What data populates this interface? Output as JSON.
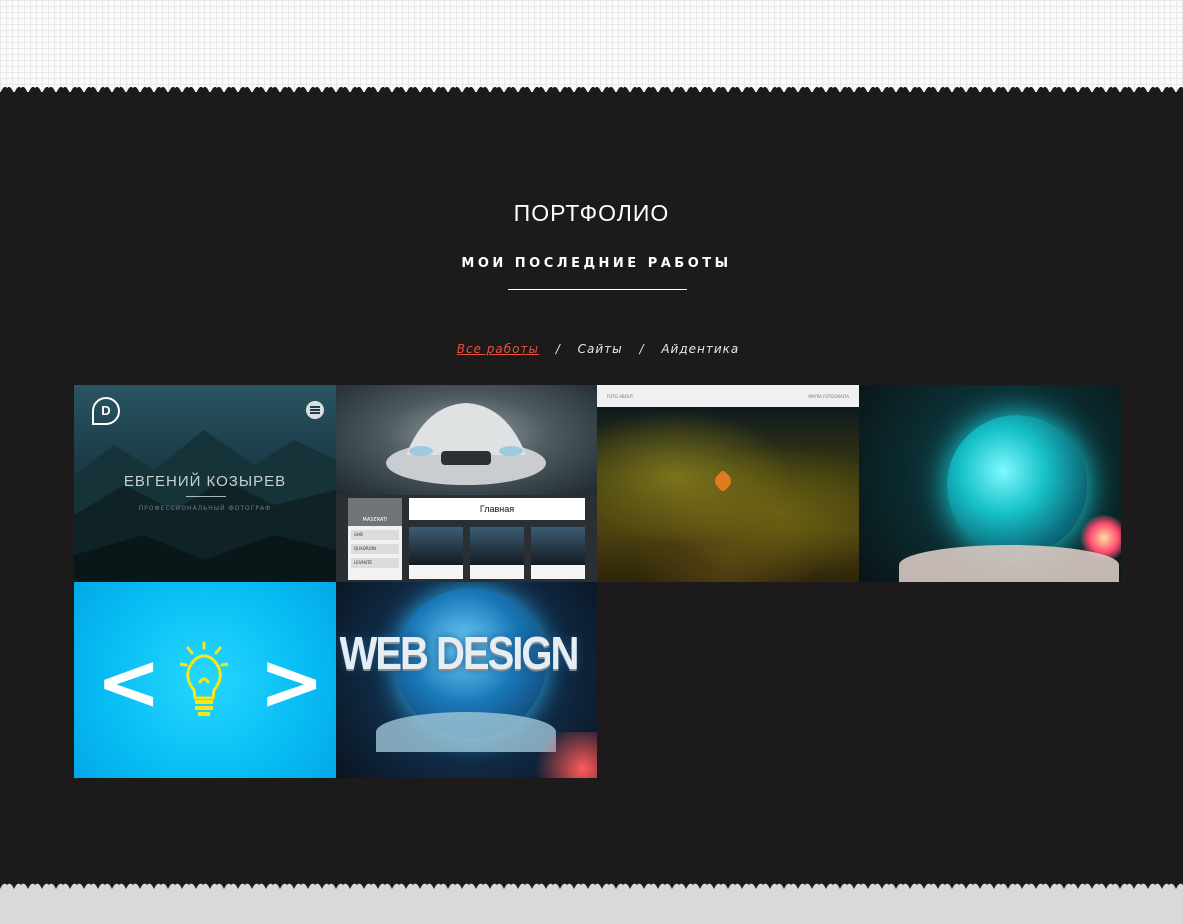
{
  "header": {
    "title": "ПОРТФОЛИО",
    "subtitle": "МОИ ПОСЛЕДНИЕ РАБОТЫ"
  },
  "filters": {
    "items": [
      "Все работы",
      "Сайты",
      "Айдентика"
    ],
    "active_index": 0,
    "separator": "/",
    "active_color": "#e8503a"
  },
  "portfolio": {
    "tile1": {
      "logo": "D",
      "name": "ЕВГЕНИЙ КОЗЫРЕВ",
      "caption": "ПРОФЕССИОНАЛЬНЫЙ ФОТОГРАФ"
    },
    "tile2": {
      "brand": "MASERATI",
      "side_items": [
        "GHB",
        "QUADROIN",
        "LEVANTE"
      ],
      "main_button": "Главная"
    },
    "tile3": {
      "bar_left": "FOTO  ABOUT",
      "bar_right": "MAYRA FOTOGRAFIA"
    },
    "tile5": {
      "left_bracket": "<",
      "right_bracket": ">"
    },
    "tile6": {
      "overlay_text": "WEB DESIGN"
    }
  },
  "colors": {
    "background_dark": "#1c1a1b",
    "text": "#ffffff",
    "accent": "#e8503a"
  }
}
